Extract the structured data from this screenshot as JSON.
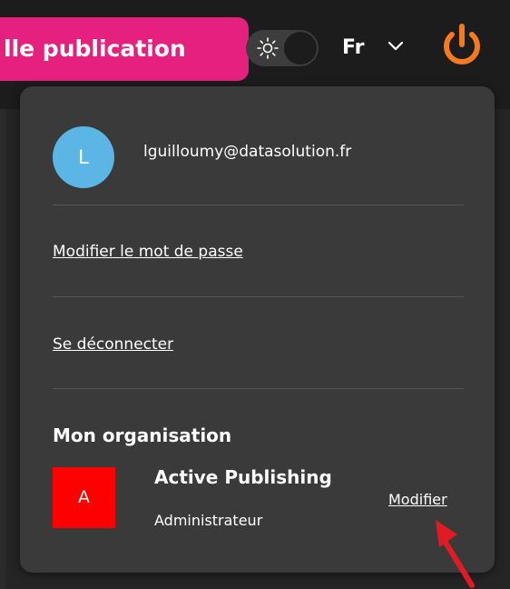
{
  "header": {
    "publish_button_label": "lle publication",
    "language": "Fr",
    "accent_color": "#e6207f",
    "power_color": "#f47a1f"
  },
  "account_menu": {
    "avatar_initial": "L",
    "avatar_color": "#5bb6e5",
    "email": "lguilloumy@datasolution.fr",
    "change_password_label": "Modifier le mot de passe",
    "logout_label": "Se déconnecter"
  },
  "organisation": {
    "heading": "Mon organisation",
    "logo_initial": "A",
    "logo_color": "#fe0000",
    "name": "Active Publishing",
    "role": "Administrateur",
    "modify_label": "Modifier"
  },
  "annotation": {
    "arrow_color": "#e01b24",
    "icon": "red-pointer-arrow"
  }
}
